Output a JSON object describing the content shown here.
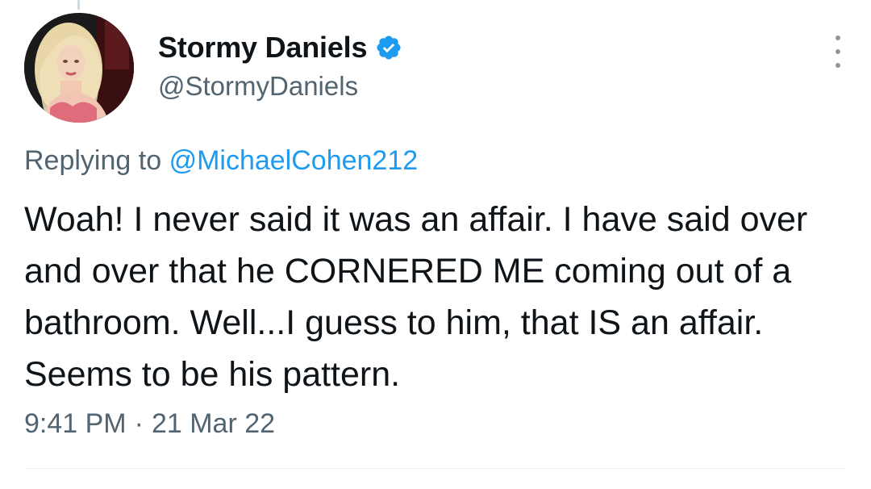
{
  "author": {
    "display_name": "Stormy Daniels",
    "handle": "@StormyDaniels",
    "verified": true
  },
  "reply": {
    "prefix": "Replying to",
    "mention": "@MichaelCohen212"
  },
  "tweet": {
    "text": "Woah! I never said it was an affair. I have said over and over that he CORNERED ME coming out of a bathroom. Well...I guess to him, that IS an affair. Seems to be his pattern."
  },
  "meta": {
    "time": "9:41 PM",
    "separator": "·",
    "date": "21 Mar 22"
  },
  "colors": {
    "verified": "#1d9bf0",
    "link": "#1d9bf0",
    "secondary_text": "#536471",
    "primary_text": "#0f1419"
  },
  "icons": {
    "verified": "verified-badge-icon",
    "more": "more-options-icon"
  }
}
